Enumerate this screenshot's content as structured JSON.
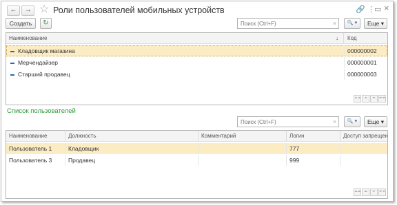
{
  "window": {
    "title": "Роли пользователей мобильных устройств",
    "back_icon": "←",
    "forward_icon": "→",
    "star_icon": "☆",
    "link_icon": "🔗",
    "menu_icon": "⋮",
    "maximize_icon": "▭",
    "close_icon": "×"
  },
  "roles_toolbar": {
    "create_label": "Создать",
    "refresh_icon": "↻",
    "search_placeholder": "Поиск (Ctrl+F)",
    "search_clear_icon": "×",
    "search_button_icon": "🔍 ▾",
    "more_label": "Еще ▾"
  },
  "roles_table": {
    "columns": [
      "Наименование",
      "↓",
      "Код"
    ],
    "rows": [
      {
        "name": "Кладовщик магазина",
        "code": "000000002"
      },
      {
        "name": "Мерчендайзер",
        "code": "000000001"
      },
      {
        "name": "Старший продавец",
        "code": "000000003"
      }
    ]
  },
  "users_section": {
    "title": "Список пользователей"
  },
  "users_toolbar": {
    "search_placeholder": "Поиск (Ctrl+F)",
    "search_clear_icon": "×",
    "search_button_icon": "🔍 ▾",
    "more_label": "Еще ▾"
  },
  "users_table": {
    "columns": [
      "Наименование",
      "Должность",
      "Комментарий",
      "Логин",
      "Доступ запрещен"
    ],
    "rows": [
      {
        "name": "Пользователь 1",
        "position": "Кладовщик",
        "comment": "",
        "login": "777",
        "denied": ""
      },
      {
        "name": "Пользователь 3",
        "position": "Продавец",
        "comment": "",
        "login": "999",
        "denied": ""
      }
    ]
  },
  "scroll": {
    "first": "⏶⏶",
    "up": "⏶",
    "down": "⏷",
    "last": "⏷⏷"
  }
}
